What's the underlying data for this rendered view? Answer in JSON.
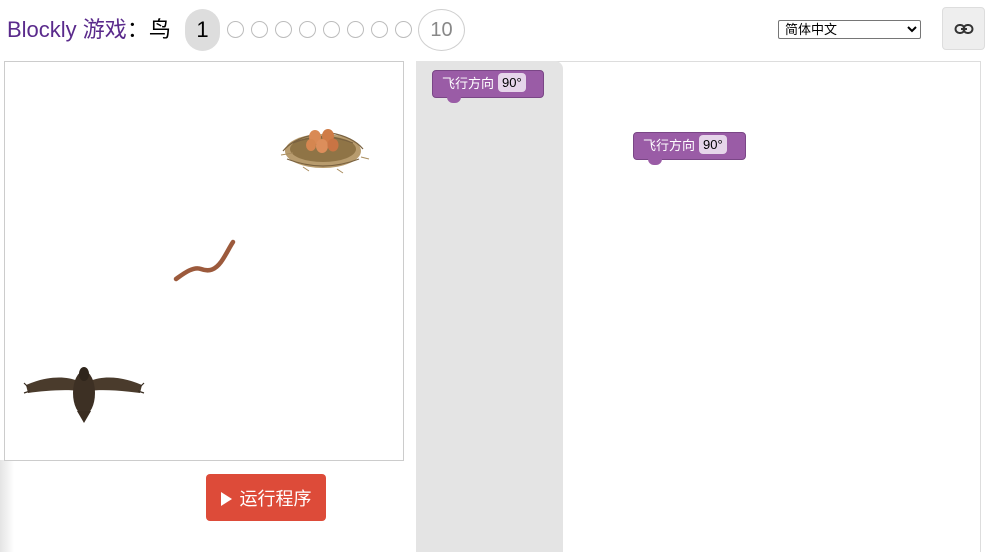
{
  "header": {
    "brand": "Blockly 游戏",
    "separator": "：",
    "level_name": "鸟",
    "levels": {
      "current": "1",
      "last": "10",
      "total": 10
    }
  },
  "language": {
    "selected": "简体中文",
    "options": [
      "简体中文"
    ]
  },
  "toolbar": {
    "link_icon": "link-icon"
  },
  "visualization": {
    "objects": [
      "nest-with-eggs",
      "worm",
      "bird"
    ]
  },
  "run_button": {
    "label": "运行程序",
    "icon": "play-icon",
    "color": "#dd4b39"
  },
  "blocks": {
    "flyout_block": {
      "label": "飞行方向",
      "value": "90°"
    },
    "workspace_block": {
      "label": "飞行方向",
      "value": "90°"
    },
    "color": "#9a5ca6"
  }
}
